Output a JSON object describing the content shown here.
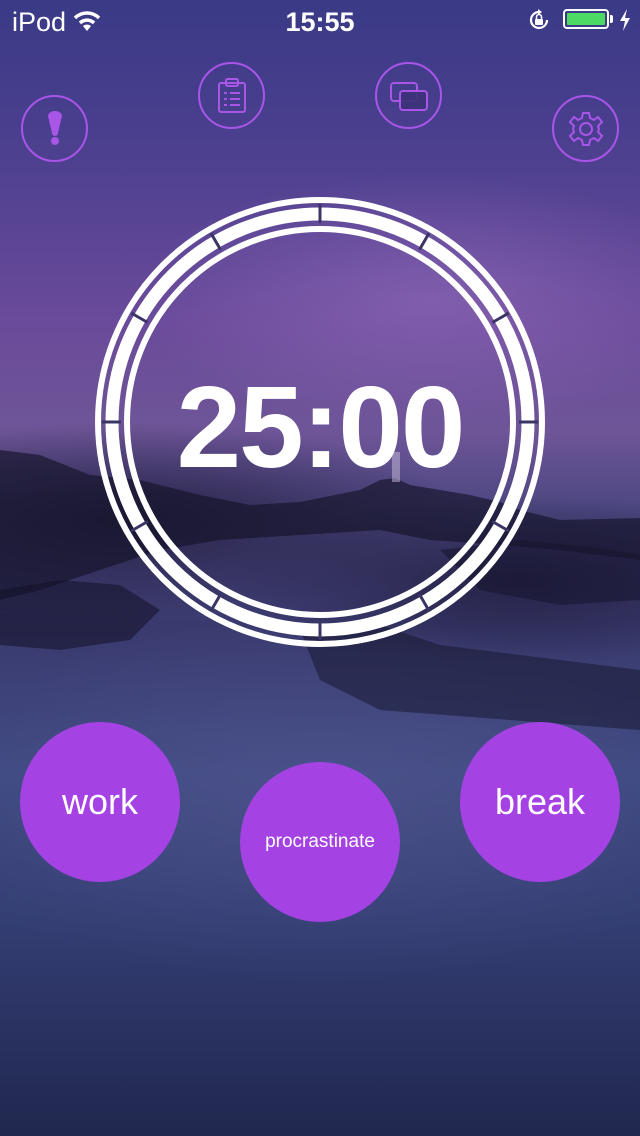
{
  "status_bar": {
    "carrier": "iPod",
    "time": "15:55",
    "battery_level": 1.0,
    "battery_color": "#4cd964"
  },
  "toolbar": {
    "info_icon": "exclamation-icon",
    "tasks_icon": "clipboard-icon",
    "windows_icon": "windows-icon",
    "settings_icon": "gear-icon",
    "accent_color": "#a855e8"
  },
  "timer": {
    "display": "25:00"
  },
  "actions": {
    "work_label": "work",
    "procrastinate_label": "procrastinate",
    "break_label": "break",
    "button_color": "#a542e3"
  }
}
